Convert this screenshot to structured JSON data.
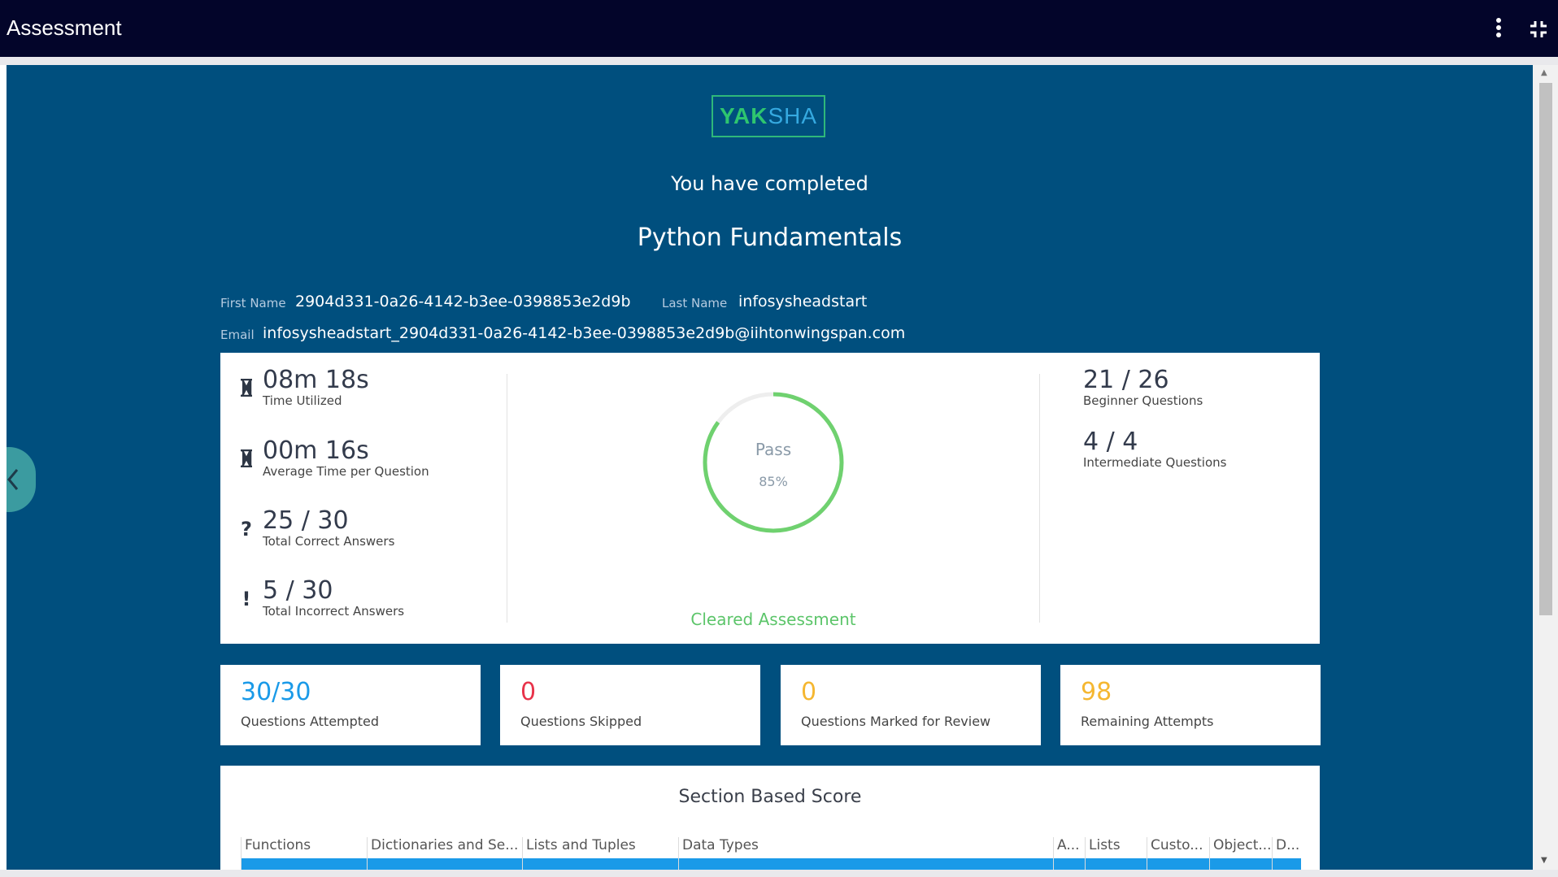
{
  "app": {
    "title": "Assessment"
  },
  "logo": {
    "part1": "YAK",
    "part2": "SHA"
  },
  "header": {
    "completed_text": "You have completed",
    "course_name": "Python Fundamentals"
  },
  "candidate": {
    "first_name_label": "First Name",
    "first_name": "2904d331-0a26-4142-b3ee-0398853e2d9b",
    "last_name_label": "Last Name",
    "last_name": "infosysheadstart",
    "email_label": "Email",
    "email": "infosysheadstart_2904d331-0a26-4142-b3ee-0398853e2d9b@iihtonwingspan.com"
  },
  "stats": {
    "time_utilized": {
      "value": "08m 18s",
      "label": "Time Utilized",
      "icon": "hourglass-icon"
    },
    "avg_time": {
      "value": "00m 16s",
      "label": "Average Time per Question",
      "icon": "hourglass-icon"
    },
    "correct": {
      "value": "25 / 30",
      "label": "Total Correct Answers",
      "icon": "question-icon"
    },
    "incorrect": {
      "value": "5 / 30",
      "label": "Total Incorrect Answers",
      "icon": "exclamation-icon"
    }
  },
  "result": {
    "status": "Pass",
    "percent_label": "85%",
    "percent": 85,
    "cleared_text": "Cleared Assessment",
    "ring_color": "#6fd16f"
  },
  "levels": {
    "beginner": {
      "value": "21 / 26",
      "label": "Beginner Questions"
    },
    "intermediate": {
      "value": "4 / 4",
      "label": "Intermediate Questions"
    }
  },
  "summary": [
    {
      "value": "30/30",
      "label": "Questions Attempted",
      "color": "#1a9ae8"
    },
    {
      "value": "0",
      "label": "Questions Skipped",
      "color": "#e8334a"
    },
    {
      "value": "0",
      "label": "Questions Marked for Review",
      "color": "#f5b731"
    },
    {
      "value": "98",
      "label": "Remaining Attempts",
      "color": "#f5b731"
    }
  ],
  "section_score": {
    "title": "Section Based Score",
    "columns": [
      "Functions",
      "Dictionaries and Se...",
      "Lists and Tuples",
      "Data Types",
      "A...",
      "Lists",
      "Custo...",
      "Object...",
      "D..."
    ]
  },
  "colors": {
    "accent_bar": "#1a9ae8",
    "main_bg": "#004f7e",
    "topbar_bg": "#03052a"
  }
}
